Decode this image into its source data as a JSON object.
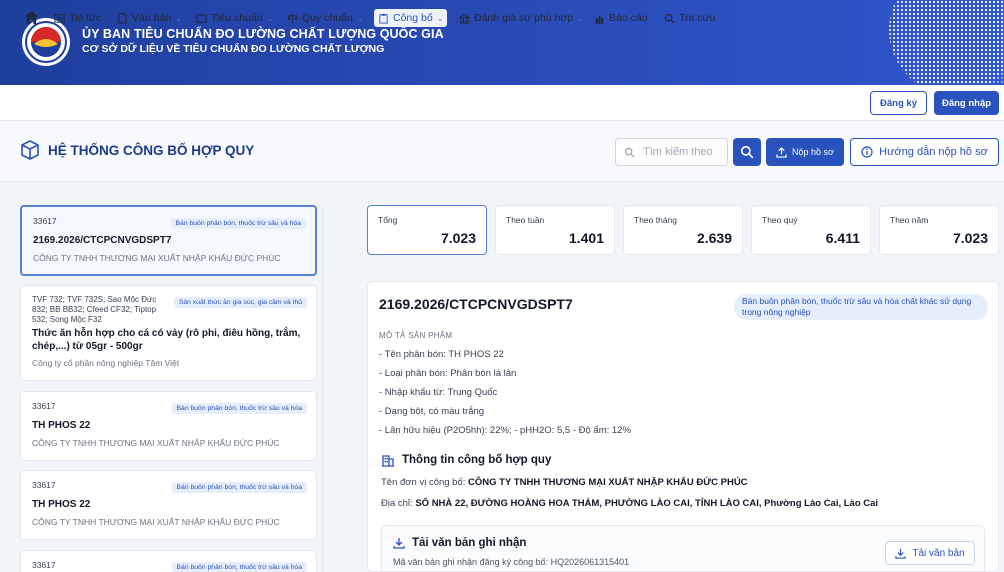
{
  "header": {
    "title": "ỦY BAN TIÊU CHUẨN ĐO LƯỜNG CHẤT LƯỢNG QUỐC GIA",
    "subtitle": "CƠ SỞ DỮ LIỆU VỀ TIÊU CHUẨN ĐO LƯỜNG CHẤT LƯỢNG"
  },
  "nav": {
    "items": [
      {
        "label": "Tin tức"
      },
      {
        "label": "Văn bản"
      },
      {
        "label": "Tiêu chuẩn"
      },
      {
        "label": "Quy chuẩn"
      },
      {
        "label": "Công bố"
      },
      {
        "label": "Đánh giá sự phù hợp"
      },
      {
        "label": "Báo cáo"
      },
      {
        "label": "Tra cứu"
      }
    ],
    "register": "Đăng ký",
    "login": "Đăng nhập"
  },
  "system": {
    "title": "HỆ THỐNG CÔNG BỐ HỢP QUY",
    "search_placeholder": "Tìm kiếm theo",
    "submit_label": "Nộp hồ sơ",
    "guide_label": "Hướng dẫn nộp hồ sơ"
  },
  "list": [
    {
      "code": "33617",
      "tag": "Bán buôn phân bón, thuốc trừ sâu và hóa",
      "name": "2169.2026/CTCPCNVGDSPT7",
      "company": "CÔNG TY TNHH THƯƠNG MẠI XUẤT NHẬP KHẨU ĐỨC PHÚC"
    },
    {
      "code": "TVF 732; TVF 732S; Sao Mộc Đức 832; BB BB32; Cfeed CF32; Tiptop 532; Song Mộc F32",
      "tag": "Sản xuất thức ăn gia súc, gia cầm và thủ",
      "name": "Thức ăn hỗn hợp cho cá có vảy (rô phi, điêu hồng, trắm, chép,...) từ 05gr - 500gr",
      "company": "Công ty cổ phần nông nghiệp Tâm Việt"
    },
    {
      "code": "33617",
      "tag": "Bán buôn phân bón, thuốc trừ sâu và hóa",
      "name": "TH PHOS 22",
      "company": "CÔNG TY TNHH THƯƠNG MẠI XUẤT NHẬP KHẨU ĐỨC PHÚC"
    },
    {
      "code": "33617",
      "tag": "Bán buôn phân bón, thuốc trừ sâu và hóa",
      "name": "TH PHOS 22",
      "company": "CÔNG TY TNHH THƯƠNG MẠI XUẤT NHẬP KHẨU ĐỨC PHÚC"
    },
    {
      "code": "33617",
      "tag": "Bán buôn phân bón, thuốc trừ sâu và hóa"
    }
  ],
  "stats": [
    {
      "label": "Tổng",
      "value": "7.023"
    },
    {
      "label": "Theo tuần",
      "value": "1.401"
    },
    {
      "label": "Theo tháng",
      "value": "2.639"
    },
    {
      "label": "Theo quý",
      "value": "6.411"
    },
    {
      "label": "Theo năm",
      "value": "7.023"
    }
  ],
  "detail": {
    "title": "2169.2026/CTCPCNVGDSPT7",
    "tag": "Bán buôn phân bón, thuốc trừ sâu và hóa chất khác sử dụng trong nông nghiệp",
    "mota_label": "MÔ TẢ SẢN PHẨM",
    "lines": [
      "- Tên phân bón: TH PHOS 22",
      "- Loại phân bón: Phân bón lá lân",
      "- Nhập khẩu từ: Trung Quốc",
      "- Dạng bột, có màu trắng",
      "- Lân hữu hiệu (P2O5hh): 22%; - pHH2O: 5,5 - Độ ẩm: 12%"
    ],
    "section_title": "Thông tin công bố hợp quy",
    "unit_label": "Tên đơn vị công bố:",
    "unit_value": "CÔNG TY TNHH THƯƠNG MẠI XUẤT NHẬP KHẨU ĐỨC PHÚC",
    "addr_label": "Địa chỉ:",
    "addr_value": "SỐ NHÀ 22, ĐƯỜNG HOÀNG HOA THÁM, PHƯỜNG LÀO CAI, TỈNH LÀO CAI, Phường Lào Cai, Lào Cai",
    "download_title": "Tải văn bản ghi nhận",
    "download_code": "Mã văn bản ghi nhận đăng ký công bố: HQ2026061315401",
    "download_btn": "Tải văn bản"
  },
  "colors": {
    "primary": "#2a52be",
    "banner": "#1f3f9e"
  }
}
